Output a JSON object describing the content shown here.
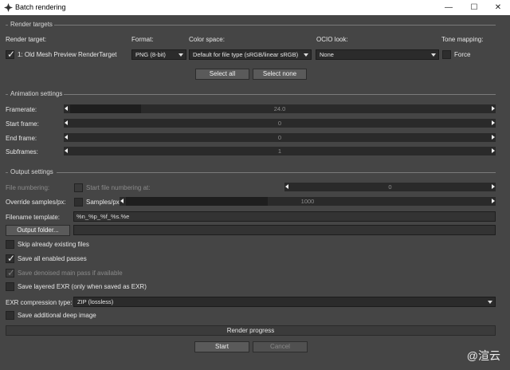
{
  "window": {
    "title": "Batch rendering"
  },
  "render_targets": {
    "section": "Render targets",
    "col_render_target": "Render target:",
    "col_format": "Format:",
    "col_color_space": "Color space:",
    "col_ocio": "OCIO look:",
    "col_tone": "Tone mapping:",
    "target_label": "1: Old Mesh Preview RenderTarget",
    "target_checked": true,
    "format_value": "PNG (8-bit)",
    "color_space_value": "Default for file type (sRGB/linear sRGB)",
    "ocio_value": "None",
    "force_label": "Force",
    "force_checked": false,
    "select_all": "Select all",
    "select_none": "Select none"
  },
  "animation": {
    "section": "Animation settings",
    "framerate_label": "Framerate:",
    "framerate_value": "24.0",
    "framerate_fill": 0.17,
    "start_label": "Start frame:",
    "start_value": "0",
    "end_label": "End frame:",
    "end_value": "0",
    "sub_label": "Subframes:",
    "sub_value": "1"
  },
  "output": {
    "section": "Output settings",
    "file_numbering_label": "File numbering:",
    "start_numbering_label": "Start file numbering at:",
    "start_numbering_value": "0",
    "override_label": "Override samples/px:",
    "samples_label": "Samples/px:",
    "samples_value": "1000",
    "samples_fill": 0.39,
    "filename_template_label": "Filename template:",
    "filename_template_value": "%n_%p_%f_%s.%e",
    "output_folder_button": "Output folder...",
    "skip_existing": "Skip already existing files",
    "save_all_passes": "Save all enabled passes",
    "save_denoised": "Save denoised main pass if available",
    "save_layered_exr": "Save layered EXR (only when saved as EXR)",
    "exr_compression_label": "EXR compression type:",
    "exr_compression_value": "ZIP (lossless)",
    "save_deep": "Save additional deep image"
  },
  "footer": {
    "progress_label": "Render progress",
    "start": "Start",
    "cancel": "Cancel"
  },
  "watermark": "@渲云",
  "colors": {
    "background": "#454545",
    "field": "#2b2b2b",
    "button": "#5a5a5a"
  }
}
